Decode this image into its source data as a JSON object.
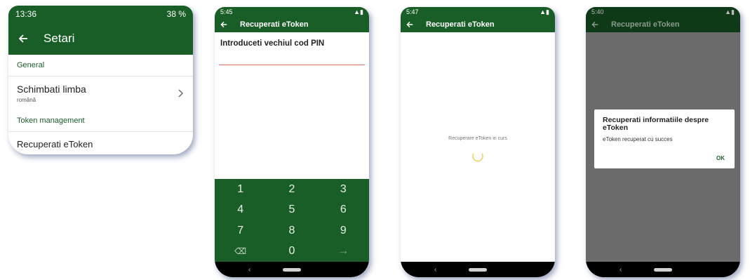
{
  "colors": {
    "brand_green": "#1a5e27",
    "error_line": "#e06b5e",
    "dim_overlay": "#6b6b6b"
  },
  "phone1": {
    "status_time": "13:36",
    "status_battery": "38 %",
    "title": "Setari",
    "section_general": "General",
    "language_label": "Schimbati limba",
    "language_value": "română",
    "section_token": "Token management",
    "recover_label": "Recuperati eToken"
  },
  "phone2": {
    "status_time": "5:45",
    "title": "Recuperati eToken",
    "pin_prompt": "Introduceti vechiul cod PIN",
    "keys": [
      "1",
      "2",
      "3",
      "4",
      "5",
      "6",
      "7",
      "8",
      "9",
      "⌫",
      "0",
      "→"
    ]
  },
  "phone3": {
    "status_time": "5:47",
    "title": "Recuperati eToken",
    "progress_text": "Recuperare eToken in curs"
  },
  "phone4": {
    "status_time": "5:40",
    "title": "Recuperati eToken",
    "dialog_title": "Recuperati informatiile despre eToken",
    "dialog_message": "eToken recuperat cu succes",
    "dialog_ok": "OK"
  }
}
